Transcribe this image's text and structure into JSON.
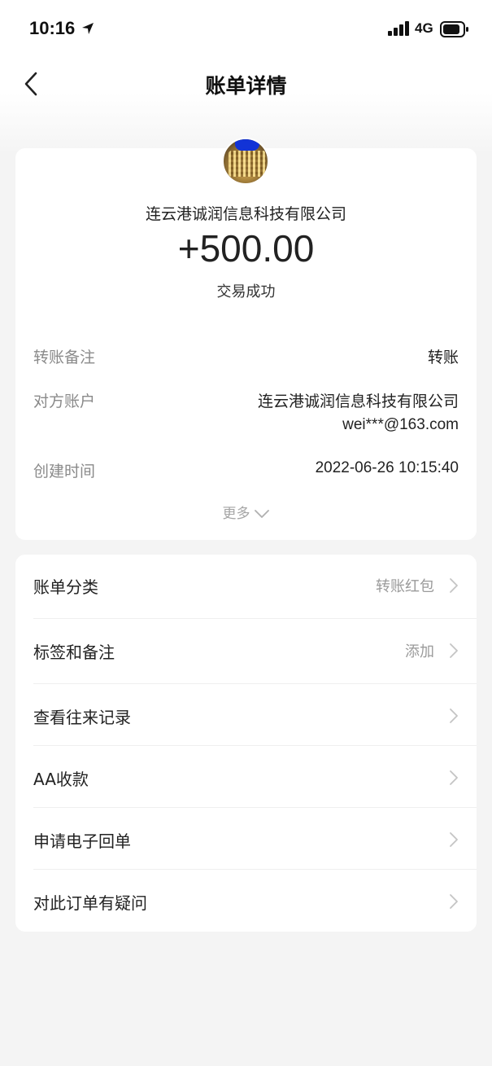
{
  "status_bar": {
    "time": "10:16",
    "network": "4G"
  },
  "nav": {
    "title": "账单详情"
  },
  "summary": {
    "payee": "连云港诚润信息科技有限公司",
    "amount": "+500.00",
    "status": "交易成功",
    "details": [
      {
        "label": "转账备注",
        "value": "转账"
      },
      {
        "label": "对方账户",
        "value": "连云港诚润信息科技有限公司",
        "value2": "wei***@163.com"
      },
      {
        "label": "创建时间",
        "value": "2022-06-26 10:15:40"
      }
    ],
    "more": "更多"
  },
  "list": [
    {
      "label": "账单分类",
      "value": "转账红包"
    },
    {
      "label": "标签和备注",
      "value": "添加"
    },
    {
      "label": "查看往来记录",
      "value": ""
    },
    {
      "label": "AA收款",
      "value": ""
    },
    {
      "label": "申请电子回单",
      "value": ""
    },
    {
      "label": "对此订单有疑问",
      "value": ""
    }
  ]
}
